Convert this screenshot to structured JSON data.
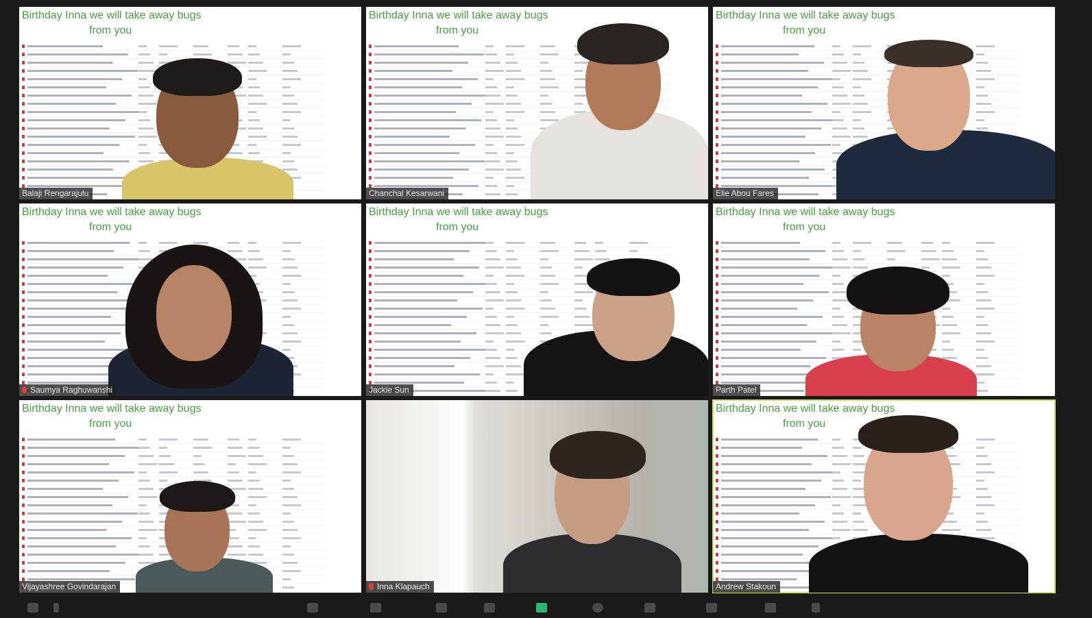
{
  "banner": {
    "line1": "Birthday Inna we will take away bugs",
    "line2": "from you"
  },
  "participants": [
    {
      "name": "Balaji Rengarajulu",
      "muted": false,
      "active": false
    },
    {
      "name": "Chanchal Kesarwani",
      "muted": false,
      "active": false
    },
    {
      "name": "Elie Abou Fares",
      "muted": false,
      "active": false
    },
    {
      "name": "Saumya Raghuwanshi",
      "muted": true,
      "active": false
    },
    {
      "name": "Jackie Sun",
      "muted": false,
      "active": false
    },
    {
      "name": "Parth Patel",
      "muted": false,
      "active": false
    },
    {
      "name": "Vijayashree Govindarajan",
      "muted": false,
      "active": false
    },
    {
      "name": "Inna Klapauch",
      "muted": true,
      "active": false
    },
    {
      "name": "Andrew Stakoun",
      "muted": false,
      "active": true
    }
  ],
  "toolbar": {
    "items": [
      "video-icon",
      "chevron-up-icon",
      "security-icon",
      "participants-icon",
      "polls-icon",
      "chat-icon",
      "share-screen-icon",
      "record-icon",
      "cc-icon",
      "reactions-icon",
      "apps-icon",
      "more-icon"
    ]
  },
  "colors": {
    "banner": "#46a23e",
    "active_border": "#c6e35a",
    "background": "#1a1a1a"
  }
}
